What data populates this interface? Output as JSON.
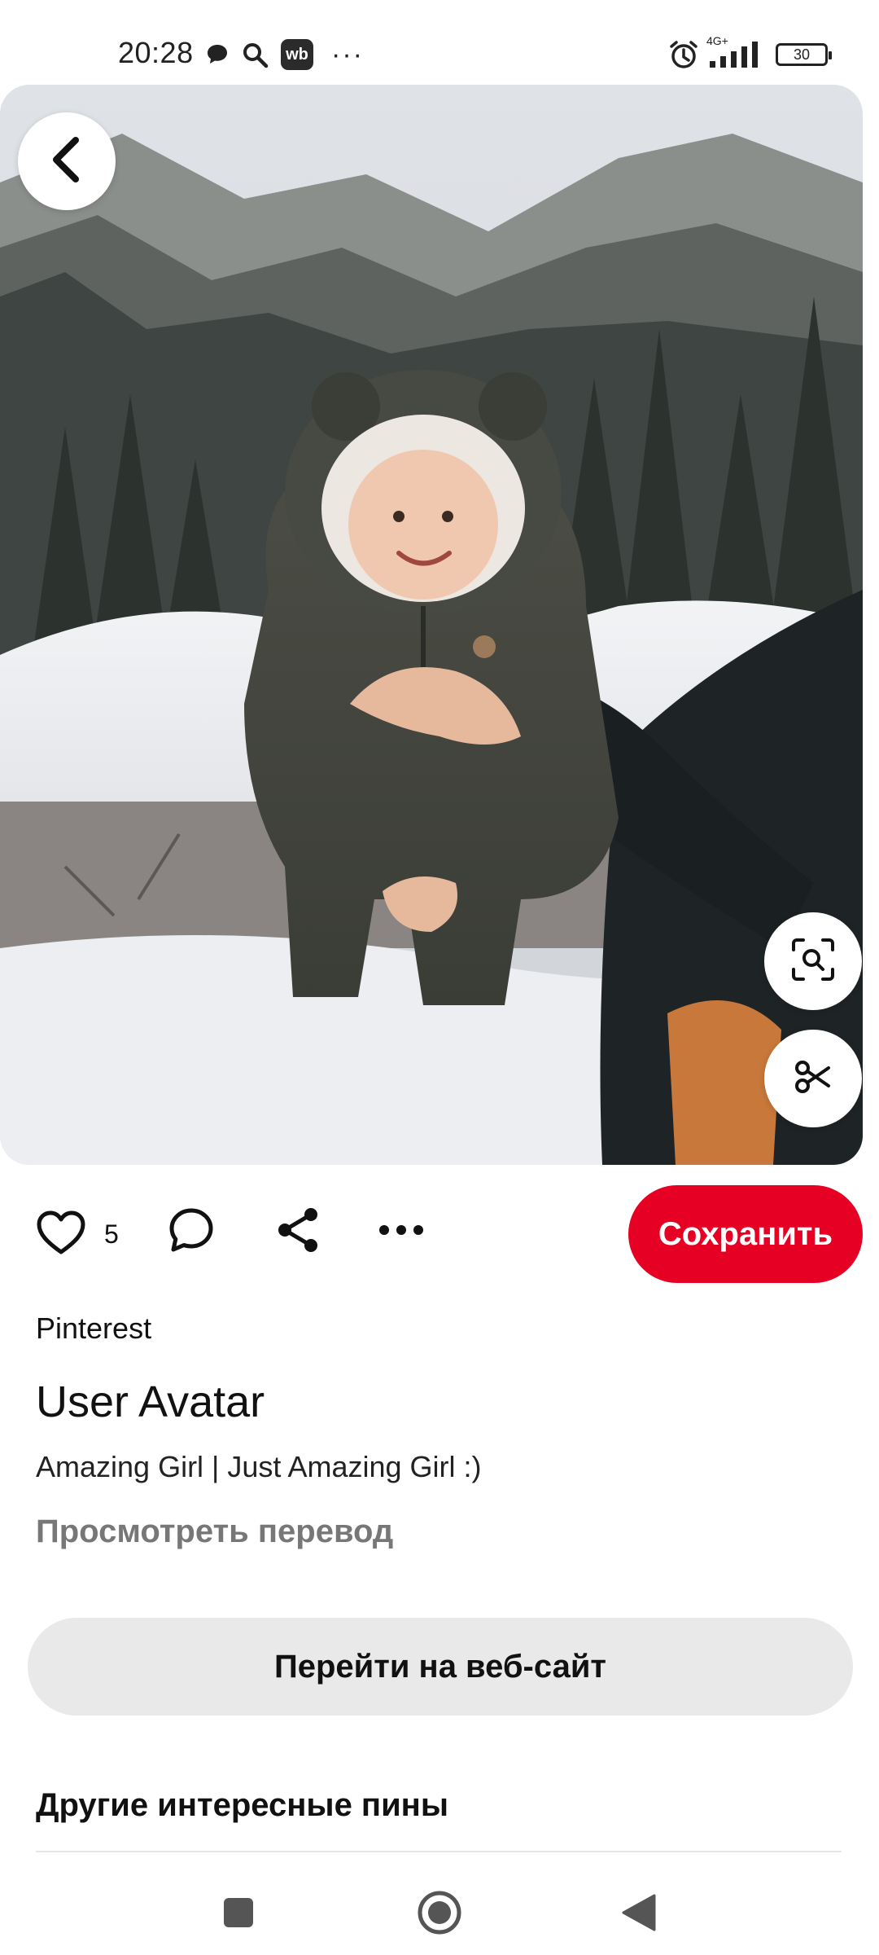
{
  "status_bar": {
    "time": "20:28",
    "network": "4G+",
    "battery": "30",
    "wb_badge": "wb",
    "more": "···",
    "icons": [
      "chat-bubble-icon",
      "search-icon",
      "wb-app-icon",
      "more-dots-icon",
      "alarm-icon",
      "signal-icon",
      "battery-icon"
    ]
  },
  "hero": {
    "icons": [
      "back-arrow-icon",
      "visual-search-icon",
      "scissors-icon"
    ]
  },
  "actions": {
    "like_count": "5",
    "save_label": "Сохранить",
    "icons": [
      "heart-icon",
      "comment-icon",
      "share-icon",
      "more-icon"
    ]
  },
  "pin": {
    "source": "Pinterest",
    "title": "User Avatar",
    "description": "Amazing Girl | Just Amazing Girl :)",
    "translate_link": "Просмотреть перевод",
    "visit_button": "Перейти на веб-сайт",
    "more_pins_heading": "Другие интересные пины"
  },
  "colors": {
    "save": "#e60023",
    "visit_bg": "#e9e9e9",
    "muted_text": "#777777"
  },
  "navbar": {
    "icons": [
      "recents-square-icon",
      "home-circle-icon",
      "back-triangle-icon"
    ]
  }
}
